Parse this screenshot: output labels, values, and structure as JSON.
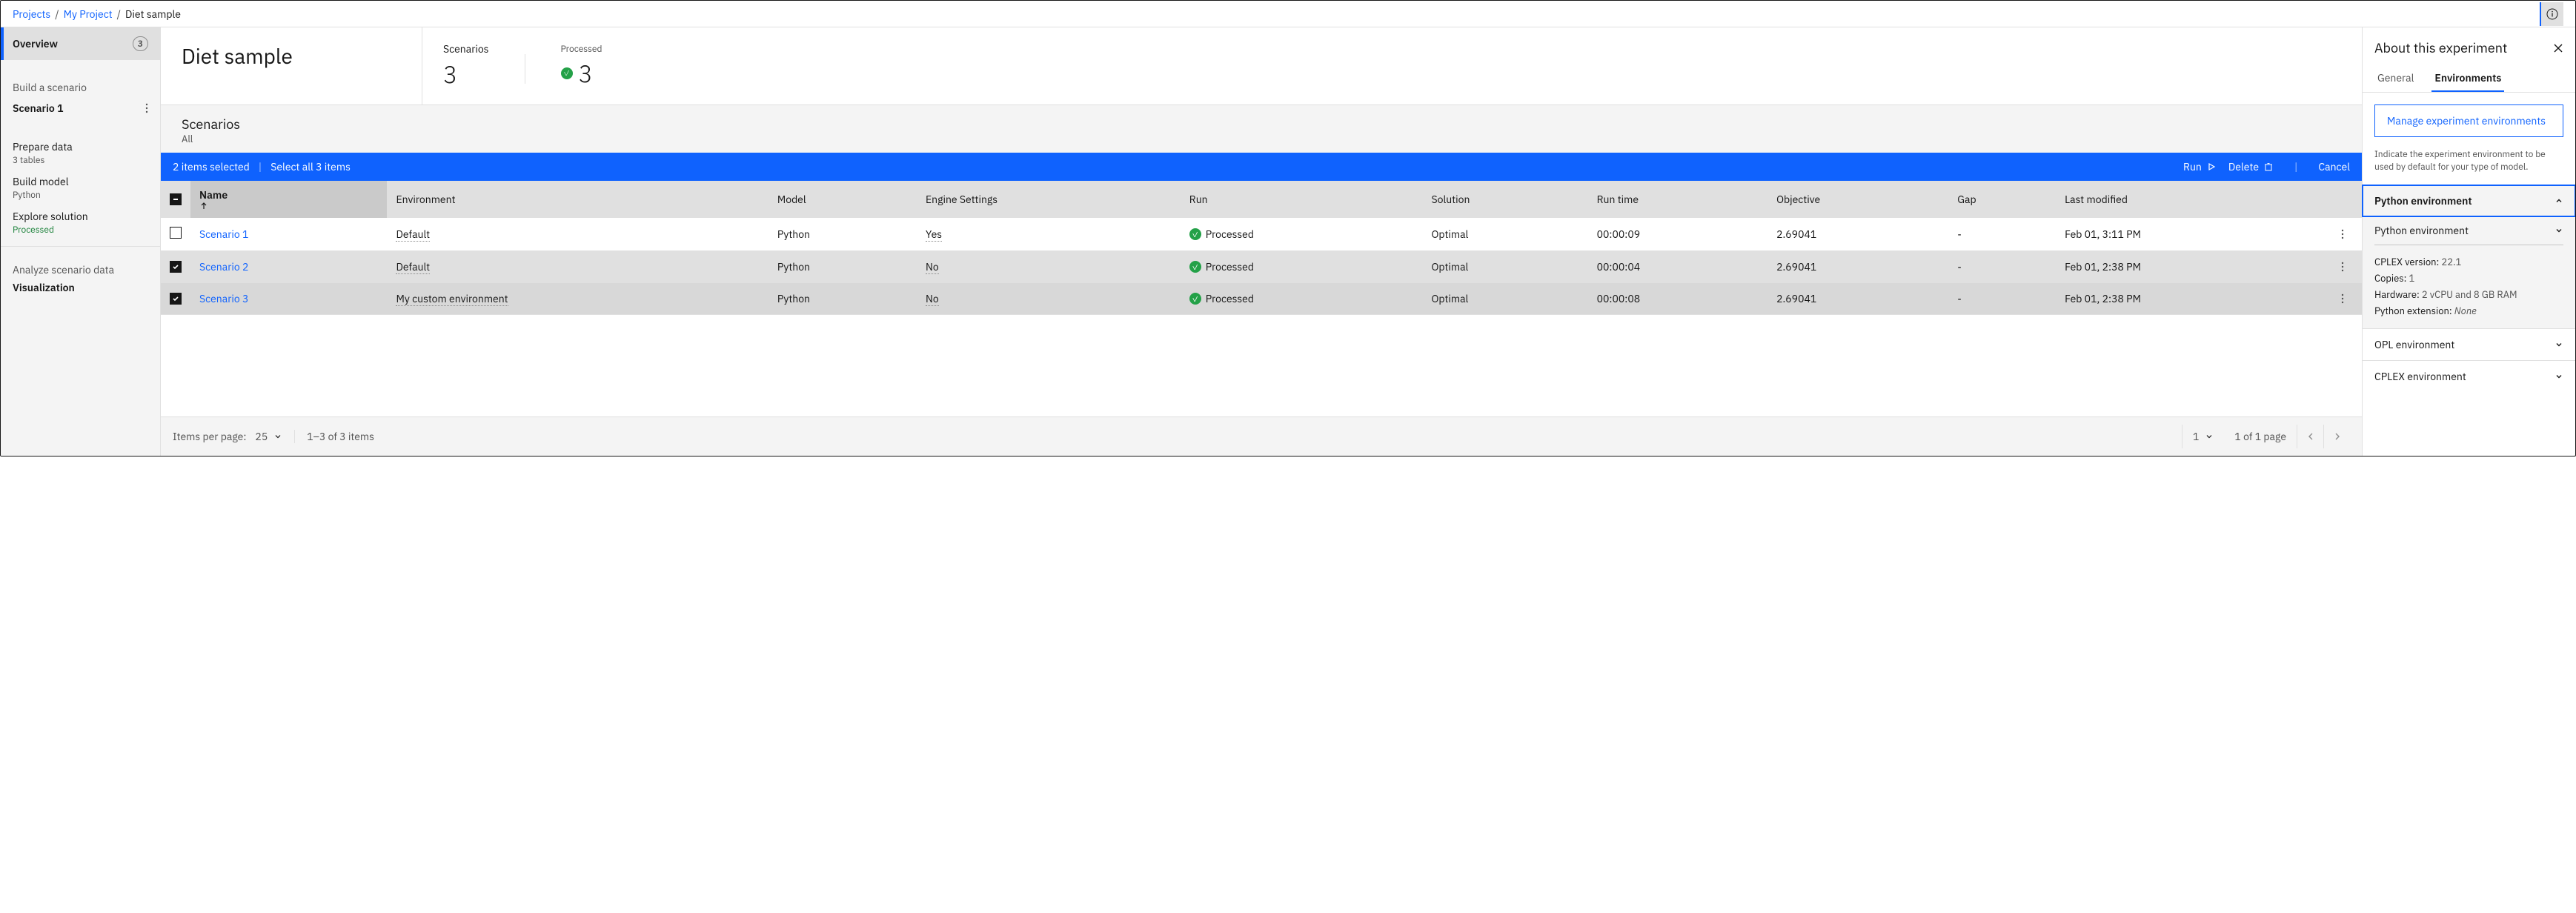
{
  "breadcrumb": {
    "projects": "Projects",
    "my_project": "My Project",
    "current": "Diet sample"
  },
  "sidebar": {
    "overview": "Overview",
    "overview_count": "3",
    "build_scenario": "Build a scenario",
    "scenario1": "Scenario 1",
    "prepare_data": "Prepare data",
    "prepare_sub": "3 tables",
    "build_model": "Build model",
    "build_sub": "Python",
    "explore": "Explore solution",
    "explore_sub": "Processed",
    "analyze": "Analyze scenario data",
    "visualization": "Visualization"
  },
  "header": {
    "title": "Diet sample",
    "scenarios_label": "Scenarios",
    "scenarios_value": "3",
    "processed_label": "Processed",
    "processed_value": "3"
  },
  "scenarios_block": {
    "title": "Scenarios",
    "subtitle": "All"
  },
  "selection": {
    "count_text": "2 items selected",
    "select_all": "Select all 3 items",
    "run": "Run",
    "delete": "Delete",
    "cancel": "Cancel"
  },
  "table": {
    "cols": {
      "name": "Name",
      "env": "Environment",
      "model": "Model",
      "engine": "Engine Settings",
      "run": "Run",
      "solution": "Solution",
      "runtime": "Run time",
      "objective": "Objective",
      "gap": "Gap",
      "modified": "Last modified"
    },
    "rows": [
      {
        "name": "Scenario 1",
        "env": "Default",
        "model": "Python",
        "engine": "Yes",
        "run": "Processed",
        "solution": "Optimal",
        "runtime": "00:00:09",
        "objective": "2.69041",
        "gap": "-",
        "modified": "Feb 01, 3:11 PM",
        "selected": false
      },
      {
        "name": "Scenario 2",
        "env": "Default",
        "model": "Python",
        "engine": "No",
        "run": "Processed",
        "solution": "Optimal",
        "runtime": "00:00:04",
        "objective": "2.69041",
        "gap": "-",
        "modified": "Feb 01, 2:38 PM",
        "selected": true
      },
      {
        "name": "Scenario 3",
        "env": "My custom environment",
        "model": "Python",
        "engine": "No",
        "run": "Processed",
        "solution": "Optimal",
        "runtime": "00:00:08",
        "objective": "2.69041",
        "gap": "-",
        "modified": "Feb 01, 2:38 PM",
        "selected": true
      }
    ]
  },
  "pagination": {
    "items_per_page": "Items per page:",
    "per_page_value": "25",
    "range": "1–3 of 3 items",
    "page_value": "1",
    "page_of": "1 of 1 page"
  },
  "panel": {
    "title": "About this experiment",
    "tab_general": "General",
    "tab_env": "Environments",
    "manage": "Manage experiment environments",
    "desc": "Indicate the experiment environment to be used by default for your type of model.",
    "python": {
      "title": "Python environment",
      "select": "Python environment",
      "cplex_k": "CPLEX version:",
      "cplex_v": "22.1",
      "copies_k": "Copies:",
      "copies_v": "1",
      "hw_k": "Hardware:",
      "hw_v": "2 vCPU and 8 GB RAM",
      "ext_k": "Python extension:",
      "ext_v": "None"
    },
    "opl": "OPL environment",
    "cplex": "CPLEX environment"
  }
}
